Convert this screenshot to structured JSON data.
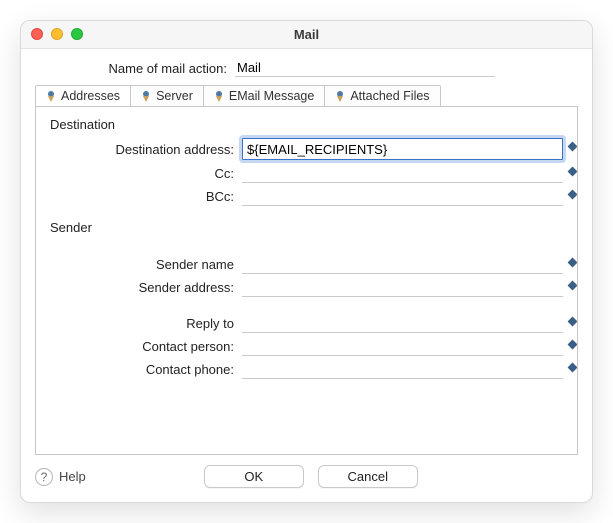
{
  "window": {
    "title": "Mail"
  },
  "nameRow": {
    "label": "Name of mail action:",
    "value": "Mail"
  },
  "tabs": [
    {
      "label": "Addresses"
    },
    {
      "label": "Server"
    },
    {
      "label": "EMail Message"
    },
    {
      "label": "Attached Files"
    }
  ],
  "sections": {
    "destination": {
      "title": "Destination",
      "fields": {
        "dest_addr": {
          "label": "Destination address:",
          "value": "${EMAIL_RECIPIENTS}"
        },
        "cc": {
          "label": "Cc:",
          "value": ""
        },
        "bcc": {
          "label": "BCc:",
          "value": ""
        }
      }
    },
    "sender": {
      "title": "Sender",
      "fields": {
        "sender_name": {
          "label": "Sender name",
          "value": ""
        },
        "sender_address": {
          "label": "Sender address:",
          "value": ""
        },
        "reply_to": {
          "label": "Reply to",
          "value": ""
        },
        "contact_person": {
          "label": "Contact person:",
          "value": ""
        },
        "contact_phone": {
          "label": "Contact phone:",
          "value": ""
        }
      }
    }
  },
  "footer": {
    "help": "Help",
    "ok": "OK",
    "cancel": "Cancel"
  }
}
